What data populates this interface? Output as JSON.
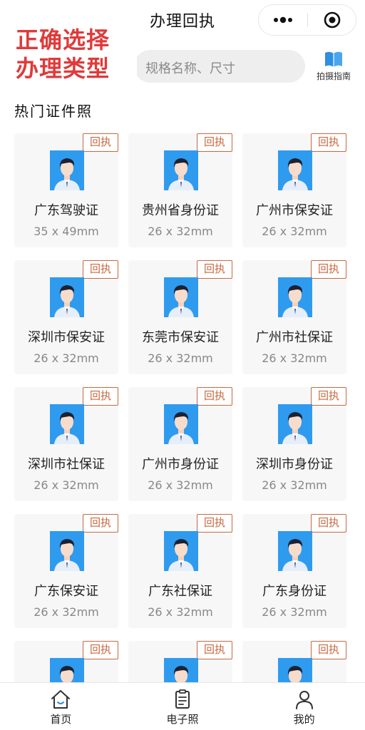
{
  "header": {
    "title": "办理回执"
  },
  "overlay": {
    "line1": "正确选择",
    "line2": "办理类型"
  },
  "search": {
    "placeholder": "规格名称、尺寸"
  },
  "guide": {
    "label": "拍摄指南",
    "icon": "book-icon"
  },
  "section": {
    "title": "热门证件照"
  },
  "badge_label": "回执",
  "cards": [
    {
      "name": "广东驾驶证",
      "size": "35 x 49mm"
    },
    {
      "name": "贵州省身份证",
      "size": "26 x 32mm"
    },
    {
      "name": "广州市保安证",
      "size": "26 x 32mm"
    },
    {
      "name": "深圳市保安证",
      "size": "26 x 32mm"
    },
    {
      "name": "东莞市保安证",
      "size": "26 x 32mm"
    },
    {
      "name": "广州市社保证",
      "size": "26 x 32mm"
    },
    {
      "name": "深圳市社保证",
      "size": "26 x 32mm"
    },
    {
      "name": "广州市身份证",
      "size": "26 x 32mm"
    },
    {
      "name": "深圳市身份证",
      "size": "26 x 32mm"
    },
    {
      "name": "广东保安证",
      "size": "26 x 32mm"
    },
    {
      "name": "广东社保证",
      "size": "26 x 32mm"
    },
    {
      "name": "广东身份证",
      "size": "26 x 32mm"
    },
    {
      "name": "",
      "size": ""
    },
    {
      "name": "",
      "size": ""
    },
    {
      "name": "",
      "size": ""
    }
  ],
  "tabs": [
    {
      "label": "首页",
      "icon": "home-icon"
    },
    {
      "label": "电子照",
      "icon": "document-icon"
    },
    {
      "label": "我的",
      "icon": "user-icon"
    }
  ],
  "colors": {
    "accent_red": "#e03a3a",
    "badge": "#c7683f",
    "photo_bg": "#2f9bef",
    "guide_blue": "#2f8fe0"
  }
}
